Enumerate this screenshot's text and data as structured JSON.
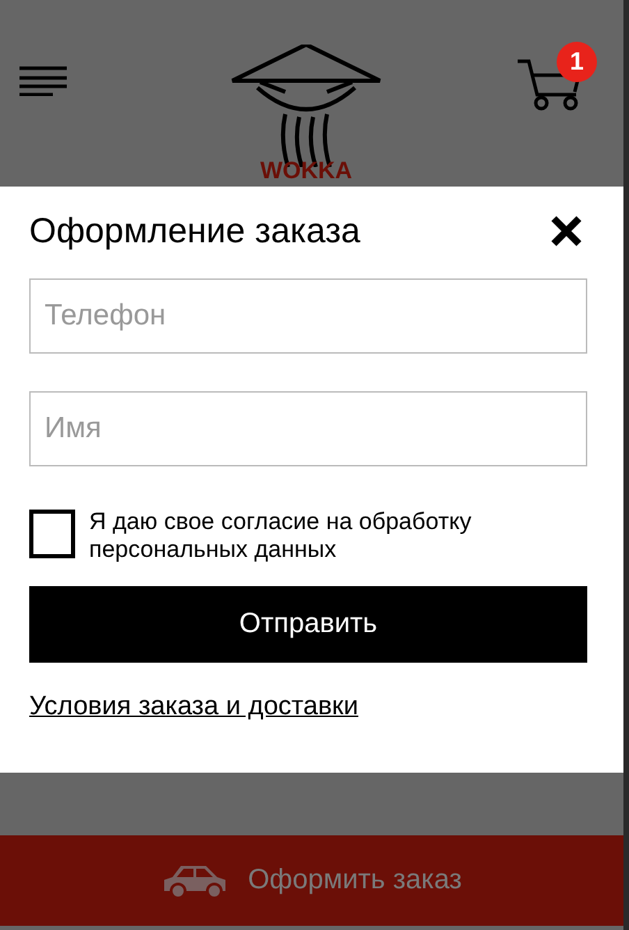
{
  "header": {
    "logo_text": "WOKKA",
    "cart_count": "1"
  },
  "modal": {
    "title": "Оформление заказа",
    "fields": [
      {
        "placeholder": "Телефон"
      },
      {
        "placeholder": "Имя"
      }
    ],
    "consent": {
      "label": "Я даю свое согласие на обработку персональных данных",
      "checked": false
    },
    "submit": "Отправить",
    "terms_link": "Условия заказа и доставки"
  },
  "footer": {
    "order_button": "Оформить заказ"
  }
}
